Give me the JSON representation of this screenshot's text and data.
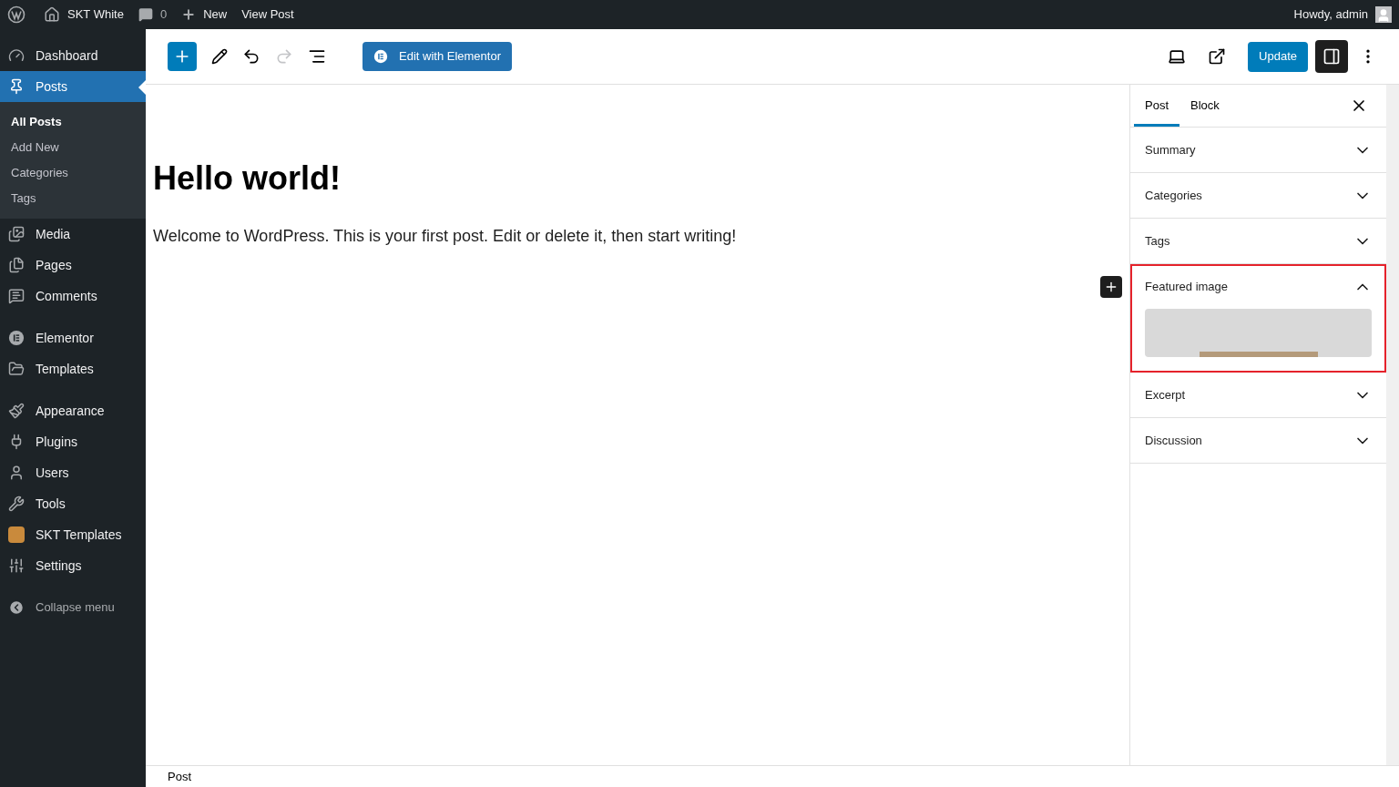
{
  "admin_bar": {
    "site": "SKT White",
    "comments": "0",
    "new": "New",
    "view": "View Post",
    "greeting": "Howdy, admin"
  },
  "sidebar": {
    "groups": [
      [
        {
          "label": "Dashboard",
          "selected": false
        },
        {
          "label": "Posts",
          "selected": true,
          "children": [
            {
              "label": "All Posts",
              "selected": true
            },
            {
              "label": "Add New",
              "selected": false
            },
            {
              "label": "Categories",
              "selected": false
            },
            {
              "label": "Tags",
              "selected": false
            }
          ]
        },
        {
          "label": "Media",
          "selected": false
        },
        {
          "label": "Pages",
          "selected": false
        },
        {
          "label": "Comments",
          "selected": false
        }
      ],
      [
        {
          "label": "Elementor",
          "selected": false
        },
        {
          "label": "Templates",
          "selected": false
        }
      ],
      [
        {
          "label": "Appearance",
          "selected": false
        },
        {
          "label": "Plugins",
          "selected": false
        },
        {
          "label": "Users",
          "selected": false
        },
        {
          "label": "Tools",
          "selected": false
        },
        {
          "label": "SKT Templates",
          "selected": false
        },
        {
          "label": "Settings",
          "selected": false
        }
      ]
    ],
    "collapse": "Collapse menu"
  },
  "toolbar": {
    "elementor_button": "Edit with Elementor",
    "update_button": "Update",
    "settings_open": true
  },
  "post": {
    "title": "Hello world!",
    "body": "Welcome to WordPress. This is your first post. Edit or delete it, then start writing!"
  },
  "settings_panel": {
    "tabs": [
      {
        "label": "Post",
        "selected": true
      },
      {
        "label": "Block",
        "selected": false
      }
    ],
    "sections": [
      {
        "label": "Summary",
        "expanded": false,
        "highlighted": false
      },
      {
        "label": "Categories",
        "expanded": false,
        "highlighted": false
      },
      {
        "label": "Tags",
        "expanded": false,
        "highlighted": false
      },
      {
        "label": "Featured image",
        "expanded": true,
        "highlighted": true
      },
      {
        "label": "Excerpt",
        "expanded": false,
        "highlighted": false
      },
      {
        "label": "Discussion",
        "expanded": false,
        "highlighted": false
      }
    ]
  },
  "footer": {
    "breadcrumb": "Post"
  }
}
